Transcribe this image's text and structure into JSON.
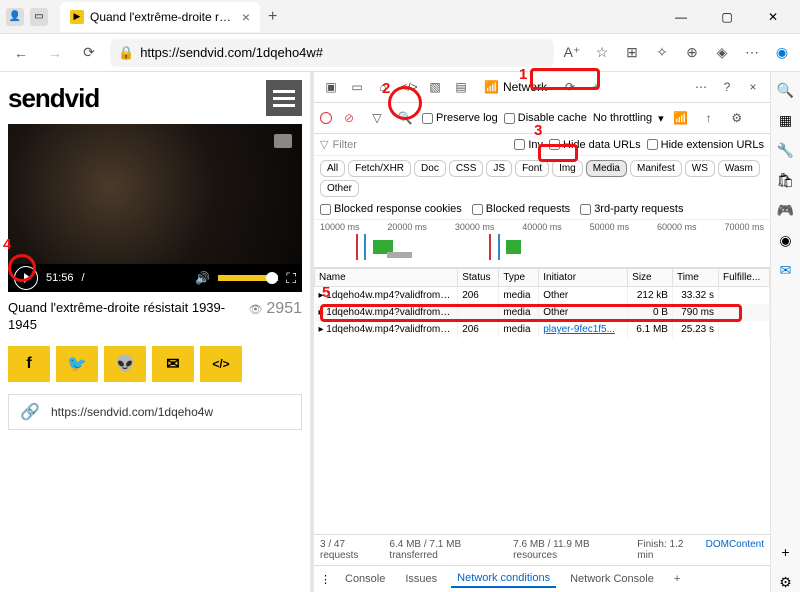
{
  "tab": {
    "title": "Quand l'extrême-droite résistait",
    "favicon": "▶"
  },
  "url": "https://sendvid.com/1dqeho4w#",
  "sendvid": {
    "logo": "sendvid",
    "video_time": "51:56",
    "video_sep": "/",
    "title": "Quand l'extrême-droite résistait 1939-1945",
    "views": "2951",
    "link": "https://sendvid.com/1dqeho4w",
    "share": {
      "fb": "f",
      "tw": "🐦",
      "rd": "👽",
      "em": "✉",
      "embed": "</>"
    }
  },
  "devtools": {
    "network_tab": "Network",
    "preserve_log": "Preserve log",
    "disable_cache": "Disable cache",
    "throttling": "No throttling",
    "filter_placeholder": "Filter",
    "invert": "Inv",
    "hide_data": "Hide data URLs",
    "hide_ext": "Hide extension URLs",
    "types": [
      "All",
      "Fetch/XHR",
      "Doc",
      "CSS",
      "JS",
      "Font",
      "Img",
      "Media",
      "Manifest",
      "WS",
      "Wasm",
      "Other"
    ],
    "blocked_cookies": "Blocked response cookies",
    "blocked_req": "Blocked requests",
    "third_party": "3rd-party requests",
    "timeline": [
      "10000 ms",
      "20000 ms",
      "30000 ms",
      "40000 ms",
      "50000 ms",
      "60000 ms",
      "70000 ms"
    ],
    "cols": [
      "Name",
      "Status",
      "Type",
      "Initiator",
      "Size",
      "Time",
      "Fulfille..."
    ],
    "rows": [
      {
        "name": "1dqeho4w.mp4?validfrom=...",
        "status": "206",
        "type": "media",
        "initiator": "Other",
        "size": "212 kB",
        "time": "33.32 s"
      },
      {
        "name": "1dqeho4w.mp4?validfrom=...",
        "status": "",
        "type": "media",
        "initiator": "Other",
        "size": "0 B",
        "time": "790 ms"
      },
      {
        "name": "1dqeho4w.mp4?validfrom=...",
        "status": "206",
        "type": "media",
        "initiator": "player-9fec1f5...",
        "size": "6.1 MB",
        "time": "25.23 s"
      }
    ],
    "status_line": {
      "req": "3 / 47 requests",
      "xfer": "6.4 MB / 7.1 MB transferred",
      "res": "7.6 MB / 11.9 MB resources",
      "fin": "Finish: 1.2 min",
      "dom": "DOMContent"
    },
    "bottom_tabs": [
      "Console",
      "Issues",
      "Network conditions",
      "Network Console"
    ]
  },
  "annotations": {
    "n1": "1",
    "n2": "2",
    "n3": "3",
    "n4": "4",
    "n5": "5"
  }
}
